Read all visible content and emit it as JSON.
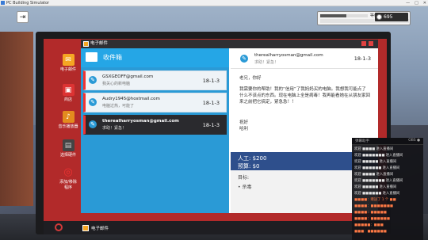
{
  "window": {
    "title": "PC Building Simulator",
    "controls": [
      "—",
      "□",
      "✕"
    ]
  },
  "hud": {
    "hud_label": "等级",
    "money": "695",
    "level_fill": 0.55
  },
  "desktop": {
    "icons": [
      {
        "label": "电子邮件",
        "glyph": "✉",
        "color": "#f5a623"
      },
      {
        "label": "商店",
        "glyph": "▣",
        "color": "#d33"
      },
      {
        "label": "音乐播放器",
        "glyph": "♪",
        "color": "#e38b1e"
      },
      {
        "label": "选择硬件",
        "glyph": "▤",
        "color": "#444"
      },
      {
        "label": "添加/移除程序",
        "glyph": "◎",
        "color": "#c22"
      }
    ],
    "taskbar_task": "电子邮件"
  },
  "app": {
    "title": "电子邮件",
    "inbox_title": "收件箱",
    "mails": [
      {
        "from": "GSXGEOFF@gmail.com",
        "preview": "我关心的新电脑",
        "date": "18-1-3"
      },
      {
        "from": "Audry1945@hostmail.com",
        "preview": "电脑过热，可能了",
        "date": "18-1-3"
      },
      {
        "from": "therealharryosman@gmail.com",
        "preview": "求助！紧急！",
        "date": "18-1-3"
      }
    ],
    "reader": {
      "from": "therealharryosman@gmail.com",
      "subject": "求助！紧急！",
      "date": "18-1-3",
      "greeting": "老兄，你好",
      "body": "我需要你的帮助！我的“信用”了我妈妈买的电脑。我想我可能点了什么不该点的东西。现在电脑上全是病毒！我再能看她在从朋友家回来之前把它搞定，紧急急！！",
      "signoff": "祝好",
      "name": "哈利",
      "labor": "人工: $200",
      "budget": "预算: $0",
      "goals_label": "目标:",
      "goal_item": "• 杀毒"
    }
  },
  "chat": {
    "header": "弹幕助手",
    "header_right": "OBS ●",
    "lines": [
      {
        "text": "欢迎 ■■■■ 进入直播间",
        "hl": false
      },
      {
        "text": "欢迎 ■■■■■■■ 进入直播间",
        "hl": false
      },
      {
        "text": "欢迎 ■■■■■ 进入直播间",
        "hl": false
      },
      {
        "text": "欢迎 ■■■■■■ 进入直播间",
        "hl": false
      },
      {
        "text": "欢迎 ■■■■ 进入直播间",
        "hl": false
      },
      {
        "text": "欢迎 ■■■■■■■ 进入直播间",
        "hl": false
      },
      {
        "text": "欢迎 ■■■■■ 进入直播间",
        "hl": false
      },
      {
        "text": "欢迎 ■■■■■■ 进入直播间",
        "hl": false
      },
      {
        "text": "■■■■：赠送了 1 个 ■■",
        "hl": true
      },
      {
        "text": "■■■■：■■■■■■■",
        "hl": true
      },
      {
        "text": "■■■■：■■■■■",
        "hl": true
      },
      {
        "text": "■■■■：■■■■■■",
        "hl": true
      },
      {
        "text": "■■■■■：■■■",
        "hl": true
      },
      {
        "text": "■■■：■■■■■■",
        "hl": true
      }
    ]
  }
}
